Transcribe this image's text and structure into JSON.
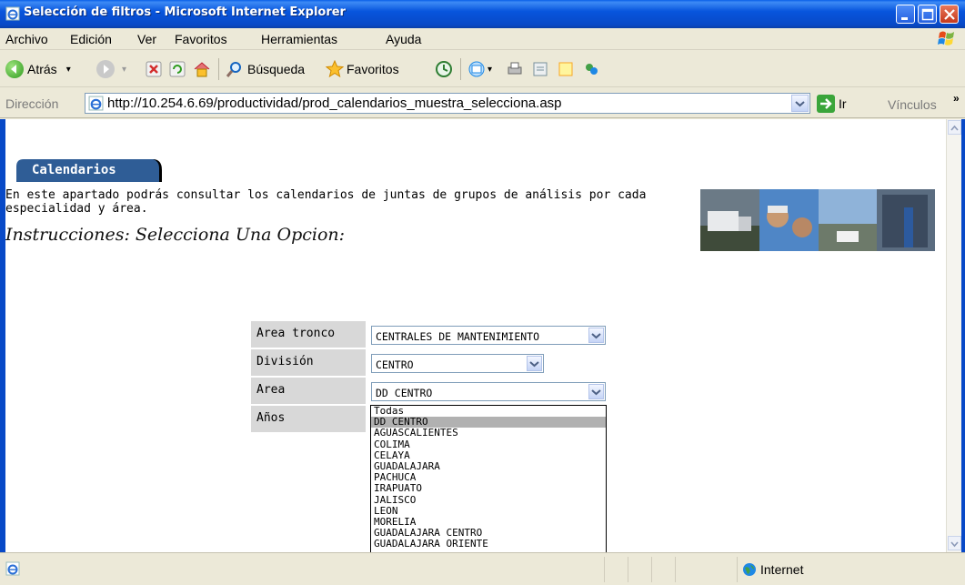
{
  "window": {
    "title": "Selección de filtros - Microsoft Internet Explorer"
  },
  "menubar": {
    "items": [
      "Archivo",
      "Edición",
      "Ver",
      "Favoritos",
      "Herramientas",
      "Ayuda"
    ]
  },
  "toolbar": {
    "back_label": "Atrás",
    "search_label": "Búsqueda",
    "favorites_label": "Favoritos"
  },
  "addressbar": {
    "label": "Dirección",
    "url": "http://10.254.6.69/productividad/prod_calendarios_muestra_selecciona.asp",
    "go_label": "Ir",
    "links_label": "Vínculos"
  },
  "page": {
    "tab_label": "Calendarios",
    "description": "En este apartado podrás consultar los calendarios de juntas de grupos de análisis por cada especialidad y área.",
    "instructions": "Instrucciones: Selecciona Una Opcion:",
    "filters": [
      {
        "label": "Area tronco",
        "value": "CENTRALES DE MANTENIMIENTO"
      },
      {
        "label": "División",
        "value": "CENTRO"
      },
      {
        "label": "Area",
        "value": "DD CENTRO"
      },
      {
        "label": "Años",
        "value": ""
      }
    ],
    "area_options": [
      "Todas",
      "DD CENTRO",
      "AGUASCALIENTES",
      "COLIMA",
      "CELAYA",
      "GUADALAJARA",
      "PACHUCA",
      "IRAPUATO",
      "JALISCO",
      "LEON",
      "MORELIA",
      "GUADALAJARA CENTRO",
      "GUADALAJARA ORIENTE"
    ],
    "selected_option": "DD CENTRO"
  },
  "statusbar": {
    "zone_label": "Internet"
  },
  "colors": {
    "titlebar": "#0855dd",
    "tab": "#2f5d96",
    "selection": "#b1b1b1"
  }
}
